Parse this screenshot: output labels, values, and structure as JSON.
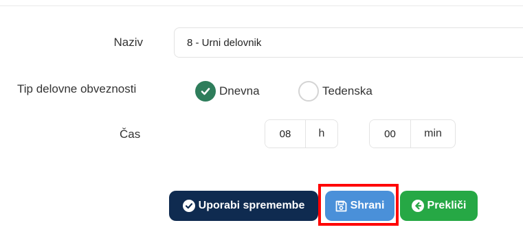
{
  "form": {
    "name_label": "Naziv",
    "name_value": "8 - Urni delovnik",
    "type_label": "Tip delovne obveznosti",
    "type_options": [
      {
        "label": "Dnevna",
        "checked": true
      },
      {
        "label": "Tedenska",
        "checked": false
      }
    ],
    "time_label": "Čas",
    "hours": {
      "value": "08",
      "unit": "h"
    },
    "minutes": {
      "value": "00",
      "unit": "min"
    }
  },
  "actions": {
    "apply_label": "Uporabi spremembe",
    "save_label": "Shrani",
    "cancel_label": "Prekliči"
  },
  "colors": {
    "checked_radio": "#2e7d5b",
    "apply_button": "#0f2b50",
    "save_button": "#4a90d9",
    "cancel_button": "#26a845",
    "highlight": "#ff0000"
  }
}
